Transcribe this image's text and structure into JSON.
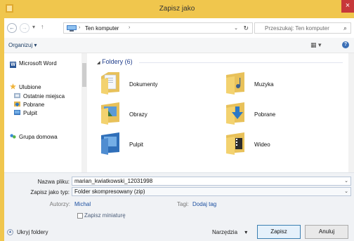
{
  "window": {
    "title": "Zapisz jako",
    "close_glyph": "×",
    "accent": "#f0c64d"
  },
  "nav": {
    "back_glyph": "←",
    "forward_glyph": "→",
    "recent_glyph": "▾",
    "up_glyph": "↑",
    "breadcrumb_sep": "›",
    "breadcrumb": "Ten komputer",
    "dropdown_glyph": "⌄",
    "refresh_glyph": "↻",
    "search_placeholder": "Przeszukaj: Ten komputer",
    "search_glyph": "⌕"
  },
  "toolbar": {
    "organize_label": "Organizuj",
    "organize_arrow": "▾",
    "view_glyph": "▦ ▾",
    "help_glyph": "?"
  },
  "sidebar": {
    "items": [
      {
        "label": "Microsoft Word",
        "icon": "word-icon"
      },
      {
        "label": "Ulubione",
        "icon": "star-icon"
      },
      {
        "label": "Ostatnie miejsca",
        "icon": "recent-places-icon"
      },
      {
        "label": "Pobrane",
        "icon": "downloads-icon"
      },
      {
        "label": "Pulpit",
        "icon": "desktop-icon"
      },
      {
        "label": "Grupa domowa",
        "icon": "homegroup-icon"
      }
    ],
    "word_letter": "W"
  },
  "content": {
    "group_label": "Foldery (6)",
    "group_arrow": "◢",
    "folders": [
      {
        "label": "Dokumenty",
        "icon": "documents-folder-icon"
      },
      {
        "label": "Muzyka",
        "icon": "music-folder-icon"
      },
      {
        "label": "Obrazy",
        "icon": "pictures-folder-icon"
      },
      {
        "label": "Pobrane",
        "icon": "downloads-folder-icon"
      },
      {
        "label": "Pulpit",
        "icon": "desktop-folder-icon"
      },
      {
        "label": "Wideo",
        "icon": "videos-folder-icon"
      }
    ]
  },
  "form": {
    "filename_label": "Nazwa pliku:",
    "filename_value": "marian_kwiatkowski_12031998",
    "filetype_label": "Zapisz jako typ:",
    "filetype_value": "Folder skompresowany (zip)",
    "dropdown_glyph": "⌄",
    "authors_label": "Autorzy:",
    "authors_value": "Michal",
    "tags_label": "Tagi:",
    "tags_value": "Dodaj tag",
    "thumbnail_label": "Zapisz miniaturę"
  },
  "footer": {
    "hide_folders_label": "Ukryj foldery",
    "hide_glyph": "▴",
    "tools_label": "Narzędzia",
    "tools_arrow": "▾",
    "save_label": "Zapisz",
    "cancel_label": "Anuluj"
  }
}
